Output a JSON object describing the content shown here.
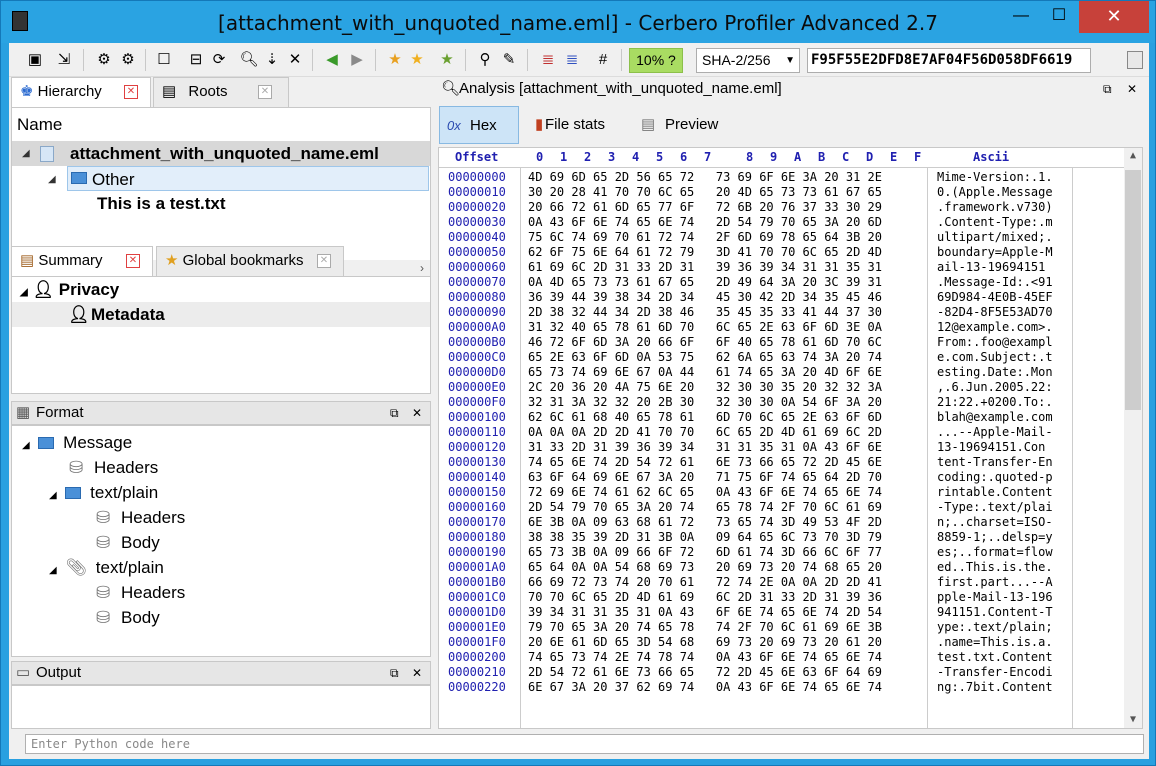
{
  "window": {
    "title": "[attachment_with_unquoted_name.eml] - Cerbero Profiler Advanced 2.7",
    "minimize": "—",
    "maximize": "☐",
    "close": "✕"
  },
  "toolbar": {
    "entropy_percent": "10% ?",
    "hash_algorithm": "SHA-2/256",
    "hash_value": "F95F55E2DFD8E7AF04F56D058DF6619"
  },
  "left_tabs": {
    "hierarchy": "Hierarchy",
    "roots": "Roots"
  },
  "hierarchy": {
    "column_header": "Name",
    "root_item": "attachment_with_unquoted_name.eml",
    "child_item": "Other",
    "grandchild_item": "This is a test.txt"
  },
  "summary_tabs": {
    "summary": "Summary",
    "bookmarks": "Global bookmarks"
  },
  "summary": {
    "privacy": "Privacy",
    "metadata": "Metadata"
  },
  "format": {
    "title": "Format",
    "items": [
      {
        "label": "Message",
        "icon": "folder-icon"
      },
      {
        "label": "Headers",
        "icon": "database-icon"
      },
      {
        "label": "text/plain",
        "icon": "folder-icon"
      },
      {
        "label": "Headers",
        "icon": "database-icon"
      },
      {
        "label": "Body",
        "icon": "database-icon"
      },
      {
        "label": "text/plain",
        "icon": "paperclip-icon"
      },
      {
        "label": "Headers",
        "icon": "database-icon"
      },
      {
        "label": "Body",
        "icon": "database-icon"
      }
    ]
  },
  "output": {
    "title": "Output"
  },
  "analysis": {
    "title": "Analysis [attachment_with_unquoted_name.eml]",
    "tabs": [
      "Hex",
      "File stats",
      "Preview"
    ],
    "tab_icons": [
      "0x"
    ]
  },
  "hex": {
    "offset_header": "Offset",
    "ascii_header": "Ascii",
    "column_headers": [
      "0",
      "1",
      "2",
      "3",
      "4",
      "5",
      "6",
      "7",
      "8",
      "9",
      "A",
      "B",
      "C",
      "D",
      "E",
      "F"
    ],
    "rows": [
      {
        "off": "00000000",
        "hex": "4D 69 6D 65 2D 56 65 72   73 69 6F 6E 3A 20 31 2E",
        "asc": "Mime-Version:.1."
      },
      {
        "off": "00000010",
        "hex": "30 20 28 41 70 70 6C 65   20 4D 65 73 73 61 67 65",
        "asc": "0.(Apple.Message"
      },
      {
        "off": "00000020",
        "hex": "20 66 72 61 6D 65 77 6F   72 6B 20 76 37 33 30 29",
        "asc": ".framework.v730)"
      },
      {
        "off": "00000030",
        "hex": "0A 43 6F 6E 74 65 6E 74   2D 54 79 70 65 3A 20 6D",
        "asc": ".Content-Type:.m"
      },
      {
        "off": "00000040",
        "hex": "75 6C 74 69 70 61 72 74   2F 6D 69 78 65 64 3B 20",
        "asc": "ultipart/mixed;."
      },
      {
        "off": "00000050",
        "hex": "62 6F 75 6E 64 61 72 79   3D 41 70 70 6C 65 2D 4D",
        "asc": "boundary=Apple-M"
      },
      {
        "off": "00000060",
        "hex": "61 69 6C 2D 31 33 2D 31   39 36 39 34 31 31 35 31",
        "asc": "ail-13-19694151"
      },
      {
        "off": "00000070",
        "hex": "0A 4D 65 73 73 61 67 65   2D 49 64 3A 20 3C 39 31",
        "asc": ".Message-Id:.<91"
      },
      {
        "off": "00000080",
        "hex": "36 39 44 39 38 34 2D 34   45 30 42 2D 34 35 45 46",
        "asc": "69D984-4E0B-45EF"
      },
      {
        "off": "00000090",
        "hex": "2D 38 32 44 34 2D 38 46   35 45 35 33 41 44 37 30",
        "asc": "-82D4-8F5E53AD70"
      },
      {
        "off": "000000A0",
        "hex": "31 32 40 65 78 61 6D 70   6C 65 2E 63 6F 6D 3E 0A",
        "asc": "12@example.com>."
      },
      {
        "off": "000000B0",
        "hex": "46 72 6F 6D 3A 20 66 6F   6F 40 65 78 61 6D 70 6C",
        "asc": "From:.foo@exampl"
      },
      {
        "off": "000000C0",
        "hex": "65 2E 63 6F 6D 0A 53 75   62 6A 65 63 74 3A 20 74",
        "asc": "e.com.Subject:.t"
      },
      {
        "off": "000000D0",
        "hex": "65 73 74 69 6E 67 0A 44   61 74 65 3A 20 4D 6F 6E",
        "asc": "esting.Date:.Mon"
      },
      {
        "off": "000000E0",
        "hex": "2C 20 36 20 4A 75 6E 20   32 30 30 35 20 32 32 3A",
        "asc": ",.6.Jun.2005.22:"
      },
      {
        "off": "000000F0",
        "hex": "32 31 3A 32 32 20 2B 30   32 30 30 0A 54 6F 3A 20",
        "asc": "21:22.+0200.To:."
      },
      {
        "off": "00000100",
        "hex": "62 6C 61 68 40 65 78 61   6D 70 6C 65 2E 63 6F 6D",
        "asc": "blah@example.com"
      },
      {
        "off": "00000110",
        "hex": "0A 0A 0A 2D 2D 41 70 70   6C 65 2D 4D 61 69 6C 2D",
        "asc": "...--Apple-Mail-"
      },
      {
        "off": "00000120",
        "hex": "31 33 2D 31 39 36 39 34   31 31 35 31 0A 43 6F 6E",
        "asc": "13-19694151.Con"
      },
      {
        "off": "00000130",
        "hex": "74 65 6E 74 2D 54 72 61   6E 73 66 65 72 2D 45 6E",
        "asc": "tent-Transfer-En"
      },
      {
        "off": "00000140",
        "hex": "63 6F 64 69 6E 67 3A 20   71 75 6F 74 65 64 2D 70",
        "asc": "coding:.quoted-p"
      },
      {
        "off": "00000150",
        "hex": "72 69 6E 74 61 62 6C 65   0A 43 6F 6E 74 65 6E 74",
        "asc": "rintable.Content"
      },
      {
        "off": "00000160",
        "hex": "2D 54 79 70 65 3A 20 74   65 78 74 2F 70 6C 61 69",
        "asc": "-Type:.text/plai"
      },
      {
        "off": "00000170",
        "hex": "6E 3B 0A 09 63 68 61 72   73 65 74 3D 49 53 4F 2D",
        "asc": "n;..charset=ISO-"
      },
      {
        "off": "00000180",
        "hex": "38 38 35 39 2D 31 3B 0A   09 64 65 6C 73 70 3D 79",
        "asc": "8859-1;..delsp=y"
      },
      {
        "off": "00000190",
        "hex": "65 73 3B 0A 09 66 6F 72   6D 61 74 3D 66 6C 6F 77",
        "asc": "es;..format=flow"
      },
      {
        "off": "000001A0",
        "hex": "65 64 0A 0A 54 68 69 73   20 69 73 20 74 68 65 20",
        "asc": "ed..This.is.the."
      },
      {
        "off": "000001B0",
        "hex": "66 69 72 73 74 20 70 61   72 74 2E 0A 0A 2D 2D 41",
        "asc": "first.part...--A"
      },
      {
        "off": "000001C0",
        "hex": "70 70 6C 65 2D 4D 61 69   6C 2D 31 33 2D 31 39 36",
        "asc": "pple-Mail-13-196"
      },
      {
        "off": "000001D0",
        "hex": "39 34 31 31 35 31 0A 43   6F 6E 74 65 6E 74 2D 54",
        "asc": "941151.Content-T"
      },
      {
        "off": "000001E0",
        "hex": "79 70 65 3A 20 74 65 78   74 2F 70 6C 61 69 6E 3B",
        "asc": "ype:.text/plain;"
      },
      {
        "off": "000001F0",
        "hex": "20 6E 61 6D 65 3D 54 68   69 73 20 69 73 20 61 20",
        "asc": ".name=This.is.a."
      },
      {
        "off": "00000200",
        "hex": "74 65 73 74 2E 74 78 74   0A 43 6F 6E 74 65 6E 74",
        "asc": "test.txt.Content"
      },
      {
        "off": "00000210",
        "hex": "2D 54 72 61 6E 73 66 65   72 2D 45 6E 63 6F 64 69",
        "asc": "-Transfer-Encodi"
      },
      {
        "off": "00000220",
        "hex": "6E 67 3A 20 37 62 69 74   0A 43 6F 6E 74 65 6E 74",
        "asc": "ng:.7bit.Content"
      }
    ]
  },
  "python": {
    "placeholder": "Enter Python code here"
  }
}
